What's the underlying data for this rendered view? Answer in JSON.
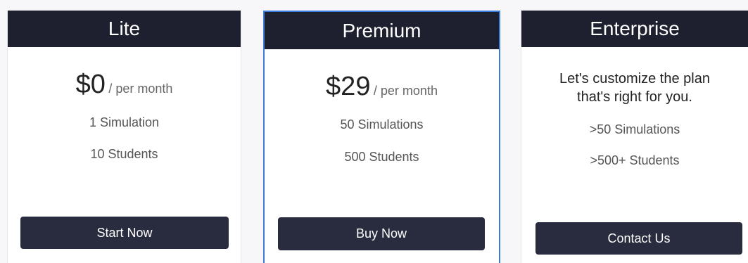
{
  "plans": {
    "lite": {
      "name": "Lite",
      "price": "$0",
      "price_unit": "/ per month",
      "features": [
        "1 Simulation",
        "10 Students"
      ],
      "cta_label": "Start Now"
    },
    "premium": {
      "name": "Premium",
      "price": "$29",
      "price_unit": "/ per month",
      "features": [
        "50 Simulations",
        "500 Students"
      ],
      "cta_label": "Buy Now"
    },
    "enterprise": {
      "name": "Enterprise",
      "tagline_line1": "Let's customize the plan",
      "tagline_line2": "that's right for you.",
      "features": [
        ">50 Simulations",
        ">500+ Students"
      ],
      "cta_label": "Contact Us"
    }
  },
  "colors": {
    "header_bg": "#1e2030",
    "button_bg": "#292c3f",
    "highlight_border": "#3b7bdc"
  }
}
